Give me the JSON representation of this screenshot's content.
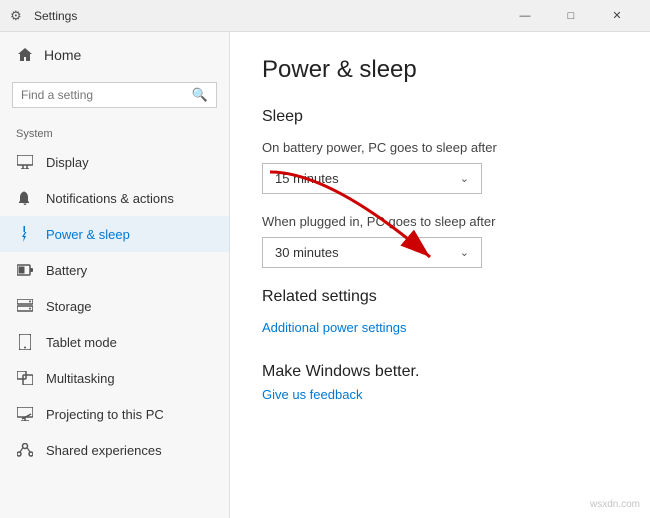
{
  "titlebar": {
    "title": "Settings",
    "minimize": "—",
    "maximize": "□",
    "close": "✕"
  },
  "sidebar": {
    "home_label": "Home",
    "search_placeholder": "Find a setting",
    "section_label": "System",
    "nav_items": [
      {
        "id": "display",
        "label": "Display",
        "icon": "display"
      },
      {
        "id": "notifications",
        "label": "Notifications & actions",
        "icon": "notifications"
      },
      {
        "id": "power",
        "label": "Power & sleep",
        "icon": "power",
        "active": true
      },
      {
        "id": "battery",
        "label": "Battery",
        "icon": "battery"
      },
      {
        "id": "storage",
        "label": "Storage",
        "icon": "storage"
      },
      {
        "id": "tablet",
        "label": "Tablet mode",
        "icon": "tablet"
      },
      {
        "id": "multitasking",
        "label": "Multitasking",
        "icon": "multitasking"
      },
      {
        "id": "projecting",
        "label": "Projecting to this PC",
        "icon": "projecting"
      },
      {
        "id": "shared",
        "label": "Shared experiences",
        "icon": "shared"
      }
    ]
  },
  "content": {
    "page_title": "Power & sleep",
    "sleep_section_title": "Sleep",
    "battery_label": "On battery power, PC goes to sleep after",
    "battery_value": "15 minutes",
    "plugged_label": "When plugged in, PC goes to sleep after",
    "plugged_value": "30 minutes",
    "related_title": "Related settings",
    "related_link": "Additional power settings",
    "make_better_title": "Make Windows better.",
    "feedback_link": "Give us feedback"
  },
  "watermark": "wsxdn.com"
}
